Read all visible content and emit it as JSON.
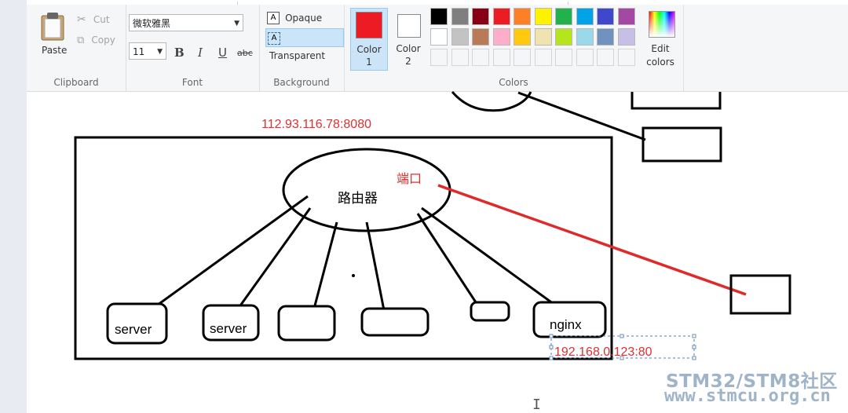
{
  "ribbon": {
    "clipboard": {
      "paste_label": "Paste",
      "cut_label": "Cut",
      "copy_label": "Copy",
      "group_label": "Clipboard"
    },
    "font": {
      "family": "微软雅黑",
      "size": "11",
      "bold": "B",
      "italic": "I",
      "underline": "U",
      "strike": "abc",
      "group_label": "Font"
    },
    "background": {
      "opaque_label": "Opaque",
      "transparent_label": "Transparent",
      "group_label": "Background"
    },
    "colors": {
      "color1_label": "Color",
      "color1_num": "1",
      "color2_label": "Color",
      "color2_num": "2",
      "color1_value": "#ed1c24",
      "color2_value": "#ffffff",
      "edit_label_line1": "Edit",
      "edit_label_line2": "colors",
      "group_label": "Colors",
      "palette_row1": [
        "#000000",
        "#7f7f7f",
        "#880015",
        "#ed1c24",
        "#ff7f27",
        "#fff200",
        "#22b14c",
        "#00a2e8",
        "#3f48cc",
        "#a349a4"
      ],
      "palette_row2": [
        "#ffffff",
        "#c3c3c3",
        "#b97a57",
        "#ffaec9",
        "#ffc90e",
        "#efe4b0",
        "#b5e61d",
        "#99d9ea",
        "#7092be",
        "#c8bfe7"
      ]
    }
  },
  "diagram": {
    "public_address": "112.93.116.78:8080",
    "router_label": "路由器",
    "port_label": "端口",
    "server1_label": "server",
    "server2_label": "server",
    "nginx_label": "nginx",
    "nginx_address": "192.168.0.123:80"
  },
  "watermark": {
    "line1": "STM32/STM8社区",
    "line2": "www.stmcu.org.cn"
  }
}
